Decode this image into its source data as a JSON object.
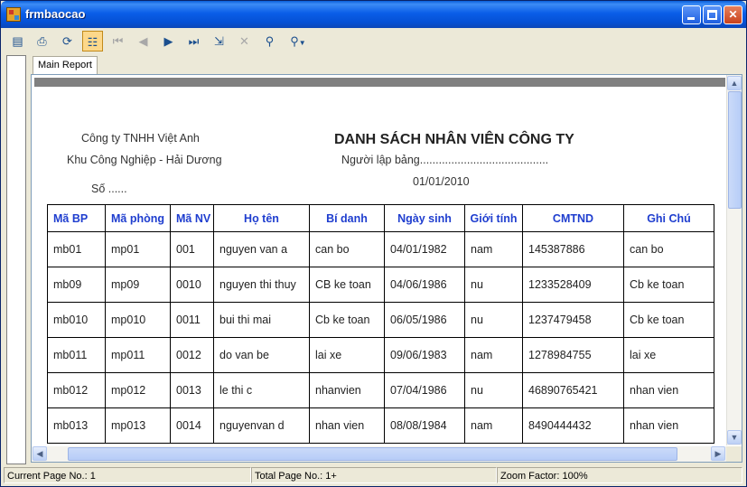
{
  "window": {
    "title": "frmbaocao"
  },
  "toolbar": {
    "items": [
      {
        "name": "export-icon",
        "glyph": "▤"
      },
      {
        "name": "print-icon",
        "glyph": "⎙"
      },
      {
        "name": "refresh-icon",
        "glyph": "⟳"
      },
      {
        "name": "group-tree-icon",
        "glyph": "☷"
      },
      {
        "name": "first-page-icon",
        "glyph": "⏮"
      },
      {
        "name": "prev-page-icon",
        "glyph": "◀"
      },
      {
        "name": "next-page-icon",
        "glyph": "▶"
      },
      {
        "name": "last-page-icon",
        "glyph": "⏭"
      },
      {
        "name": "goto-page-icon",
        "glyph": "⇲"
      },
      {
        "name": "stop-icon",
        "glyph": "✕"
      },
      {
        "name": "find-icon",
        "glyph": "⚲"
      },
      {
        "name": "zoom-icon",
        "glyph": "⚲"
      }
    ]
  },
  "tab": {
    "label": "Main Report"
  },
  "report": {
    "company_name": "Công ty TNHH Việt Anh",
    "company_address": "Khu Công Nghiệp - Hải Dương",
    "number_label": "Số ......",
    "title": "DANH SÁCH NHÂN VIÊN CÔNG TY",
    "prepared_by": "Người lập bảng.........................................",
    "date": "01/01/2010",
    "columns": [
      "Mã BP",
      "Mã phòng",
      "Mã NV",
      "Họ tên",
      "Bí danh",
      "Ngày sinh",
      "Giới tính",
      "CMTND",
      "Ghi Chú"
    ],
    "rows": [
      [
        "mb01",
        "mp01",
        "001",
        "nguyen van a",
        "can bo",
        "04/01/1982",
        "nam",
        "145387886",
        "can bo"
      ],
      [
        "mb09",
        "mp09",
        "0010",
        "nguyen thi thuy",
        "CB ke toan",
        "04/06/1986",
        "nu",
        "1233528409",
        "Cb ke toan"
      ],
      [
        "mb010",
        "mp010",
        "0011",
        "bui thi mai",
        "Cb ke toan",
        "06/05/1986",
        "nu",
        "1237479458",
        "Cb ke toan"
      ],
      [
        "mb011",
        "mp011",
        "0012",
        "do van be",
        "lai xe",
        "09/06/1983",
        "nam",
        "1278984755",
        "lai xe"
      ],
      [
        "mb012",
        "mp012",
        "0013",
        "le thi c",
        "nhanvien",
        "07/04/1986",
        "nu",
        "46890765421",
        "nhan vien"
      ],
      [
        "mb013",
        "mp013",
        "0014",
        "nguyenvan d",
        "nhan vien",
        "08/08/1984",
        "nam",
        "8490444432",
        "nhan vien"
      ]
    ]
  },
  "status": {
    "current_page": "Current Page No.: 1",
    "total_page": "Total Page No.: 1+",
    "zoom": "Zoom Factor: 100%"
  }
}
